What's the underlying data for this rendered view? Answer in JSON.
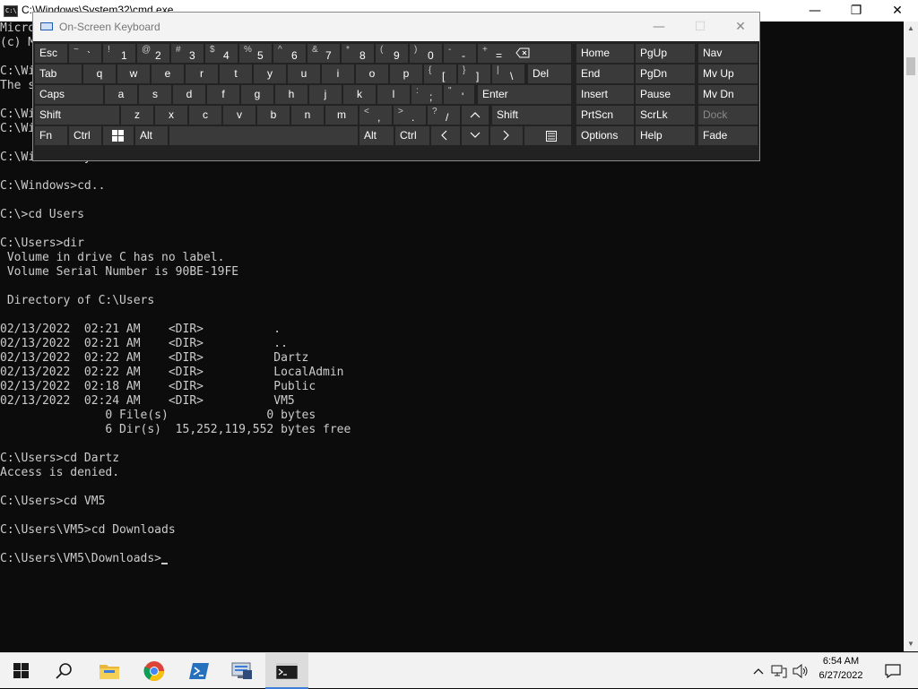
{
  "cmd": {
    "title": "C:\\Windows\\System32\\cmd.exe",
    "icon_text": "C:\\",
    "buttons": {
      "minimize": "—",
      "restore": "❐",
      "close": "✕"
    },
    "lines": [
      "Micro",
      "(c) M",
      "",
      "C:\\Wi",
      "The s",
      "",
      "C:\\Wi",
      "C:\\Wi",
      "",
      "C:\\Windows\\System32>",
      "",
      "C:\\Windows>cd..",
      "",
      "C:\\>cd Users",
      "",
      "C:\\Users>dir",
      " Volume in drive C has no label.",
      " Volume Serial Number is 90BE-19FE",
      "",
      " Directory of C:\\Users",
      "",
      "02/13/2022  02:21 AM    <DIR>          .",
      "02/13/2022  02:21 AM    <DIR>          ..",
      "02/13/2022  02:22 AM    <DIR>          Dartz",
      "02/13/2022  02:22 AM    <DIR>          LocalAdmin",
      "02/13/2022  02:18 AM    <DIR>          Public",
      "02/13/2022  02:24 AM    <DIR>          VM5",
      "               0 File(s)              0 bytes",
      "               6 Dir(s)  15,252,119,552 bytes free",
      "",
      "C:\\Users>cd Dartz",
      "Access is denied.",
      "",
      "C:\\Users>cd VM5",
      "",
      "C:\\Users\\VM5>cd Downloads",
      "",
      "C:\\Users\\VM5\\Downloads>"
    ]
  },
  "osk": {
    "title": "On-Screen Keyboard",
    "buttons": {
      "minimize": "—",
      "maximize": "☐",
      "close": "✕"
    },
    "keys": {
      "esc": "Esc",
      "tab": "Tab",
      "caps": "Caps",
      "shift_left": "Shift",
      "fn": "Fn",
      "ctrl_left": "Ctrl",
      "alt_left": "Alt",
      "del": "Del",
      "enter": "Enter",
      "shift_right": "Shift",
      "alt_right": "Alt",
      "ctrl_right": "Ctrl",
      "home": "Home",
      "pgup": "PgUp",
      "nav": "Nav",
      "end": "End",
      "pgdn": "PgDn",
      "mvup": "Mv Up",
      "insert": "Insert",
      "pause": "Pause",
      "mvdn": "Mv Dn",
      "prtscn": "PrtScn",
      "scrlk": "ScrLk",
      "dock": "Dock",
      "options": "Options",
      "help": "Help",
      "fade": "Fade"
    },
    "number_row": [
      {
        "shift": "~",
        "main": "`"
      },
      {
        "shift": "!",
        "main": "1"
      },
      {
        "shift": "@",
        "main": "2"
      },
      {
        "shift": "#",
        "main": "3"
      },
      {
        "shift": "$",
        "main": "4"
      },
      {
        "shift": "%",
        "main": "5"
      },
      {
        "shift": "^",
        "main": "6"
      },
      {
        "shift": "&",
        "main": "7"
      },
      {
        "shift": "*",
        "main": "8"
      },
      {
        "shift": "(",
        "main": "9"
      },
      {
        "shift": ")",
        "main": "0"
      },
      {
        "shift": "-",
        "main": "-"
      },
      {
        "shift": "+",
        "main": "="
      }
    ],
    "row_q": [
      "q",
      "w",
      "e",
      "r",
      "t",
      "y",
      "u",
      "i",
      "o",
      "p"
    ],
    "row_q_symbols": [
      {
        "shift": "{",
        "main": "["
      },
      {
        "shift": "}",
        "main": "]"
      },
      {
        "shift": "|",
        "main": "\\"
      }
    ],
    "row_a": [
      "a",
      "s",
      "d",
      "f",
      "g",
      "h",
      "j",
      "k",
      "l"
    ],
    "row_a_symbols": [
      {
        "shift": ":",
        "main": ";"
      },
      {
        "shift": "\"",
        "main": "'"
      }
    ],
    "row_z": [
      "z",
      "x",
      "c",
      "v",
      "b",
      "n",
      "m"
    ],
    "row_z_symbols": [
      {
        "shift": "<",
        "main": ","
      },
      {
        "shift": ">",
        "main": "."
      },
      {
        "shift": "?",
        "main": "/"
      }
    ]
  },
  "taskbar": {
    "clock_time": "6:54 AM",
    "clock_date": "6/27/2022"
  }
}
